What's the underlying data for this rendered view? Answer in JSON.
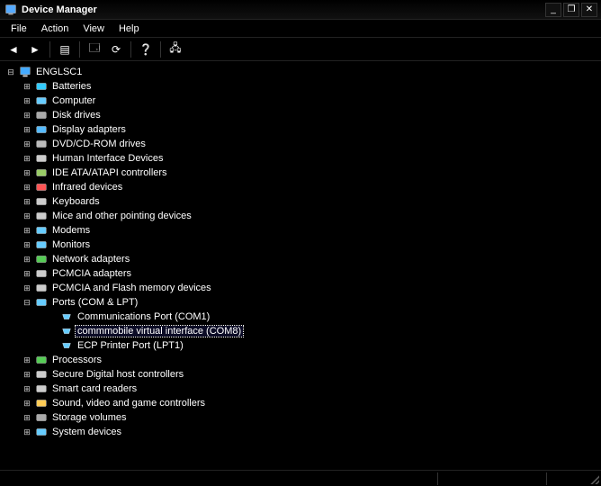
{
  "window": {
    "title": "Device Manager",
    "buttons": {
      "min": "_",
      "max": "❐",
      "close": "✕"
    }
  },
  "menubar": [
    "File",
    "Action",
    "View",
    "Help"
  ],
  "toolbar": {
    "back": "◄",
    "forward": "►",
    "show_hidden": "▤",
    "properties": "🗔",
    "refresh": "⟳",
    "help": "❔",
    "scan": "🖧"
  },
  "root": {
    "label": "ENGLSC1"
  },
  "categories": [
    {
      "label": "Batteries",
      "iconColor": "#3cf"
    },
    {
      "label": "Computer",
      "iconColor": "#6cf"
    },
    {
      "label": "Disk drives",
      "iconColor": "#aaa"
    },
    {
      "label": "Display adapters",
      "iconColor": "#5bf"
    },
    {
      "label": "DVD/CD-ROM drives",
      "iconColor": "#bbb"
    },
    {
      "label": "Human Interface Devices",
      "iconColor": "#ccc"
    },
    {
      "label": "IDE ATA/ATAPI controllers",
      "iconColor": "#9c6"
    },
    {
      "label": "Infrared devices",
      "iconColor": "#f55"
    },
    {
      "label": "Keyboards",
      "iconColor": "#ccc"
    },
    {
      "label": "Mice and other pointing devices",
      "iconColor": "#ccc"
    },
    {
      "label": "Modems",
      "iconColor": "#6cf"
    },
    {
      "label": "Monitors",
      "iconColor": "#6cf"
    },
    {
      "label": "Network adapters",
      "iconColor": "#5c5"
    },
    {
      "label": "PCMCIA adapters",
      "iconColor": "#ccc"
    },
    {
      "label": "PCMCIA and Flash memory devices",
      "iconColor": "#ccc"
    },
    {
      "label": "Ports (COM & LPT)",
      "expanded": true,
      "iconColor": "#6cf",
      "children": [
        {
          "label": "Communications Port (COM1)",
          "iconColor": "#6cf"
        },
        {
          "label": "commmobile virtual interface (COM8)",
          "selected": true,
          "iconColor": "#6cf"
        },
        {
          "label": "ECP Printer Port (LPT1)",
          "iconColor": "#6cf"
        }
      ]
    },
    {
      "label": "Processors",
      "iconColor": "#5c5"
    },
    {
      "label": "Secure Digital host controllers",
      "iconColor": "#ccc"
    },
    {
      "label": "Smart card readers",
      "iconColor": "#ccc"
    },
    {
      "label": "Sound, video and game controllers",
      "iconColor": "#fc5"
    },
    {
      "label": "Storage volumes",
      "iconColor": "#aaa"
    },
    {
      "label": "System devices",
      "iconColor": "#6cf"
    }
  ]
}
